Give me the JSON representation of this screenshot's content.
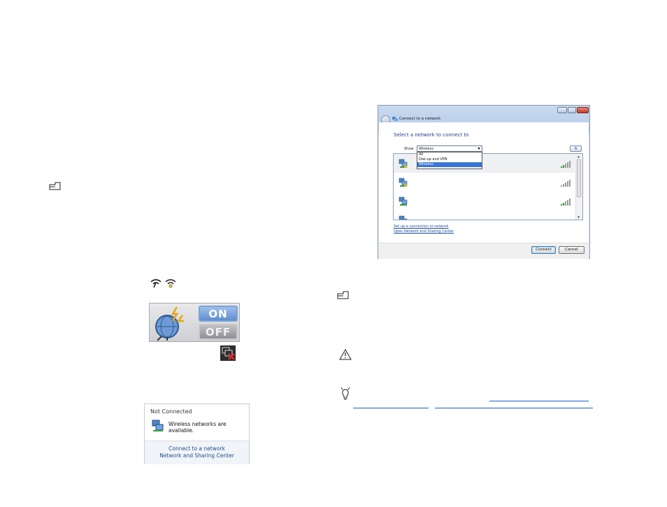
{
  "colors": {
    "link": "#1e4e9a",
    "dialog_heading": "#1e3f8a",
    "selection": "#3875d7",
    "switch_on": "#5f8fcf"
  },
  "page_icons": [
    "note-icon",
    "note-icon",
    "warning-icon",
    "tip-icon"
  ],
  "wireless_switch": {
    "on_label": "ON",
    "off_label": "OFF",
    "state": "on"
  },
  "tray_popup": {
    "title": "Not Connected",
    "message": "Wireless networks are available.",
    "links": [
      "Connect to a network",
      "Network and Sharing Center"
    ]
  },
  "dialog": {
    "title": "Connect to a network",
    "heading": "Select a network to connect to",
    "show_label": "Show",
    "show_value": "Wireless",
    "show_options": [
      "All",
      "Dial-up and VPN",
      "Wireless"
    ],
    "selected_option": "Wireless",
    "networks": [
      {
        "icon": "network-icon",
        "signal": "signal-strength-icon"
      },
      {
        "icon": "network-icon",
        "signal": "signal-strength-icon"
      },
      {
        "icon": "network-icon",
        "signal": "signal-strength-icon"
      },
      {
        "icon": "network-icon",
        "signal": "signal-strength-icon"
      }
    ],
    "links": [
      "Set up a connection or network",
      "Open Network and Sharing Center"
    ],
    "connect_label": "Connect",
    "cancel_label": "Cancel"
  }
}
